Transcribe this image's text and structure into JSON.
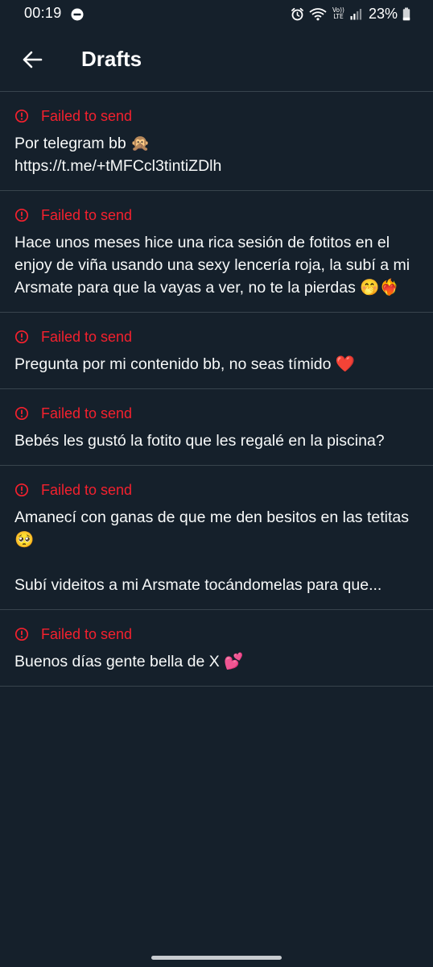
{
  "status_bar": {
    "time": "00:19",
    "battery": "23%",
    "network_label": "LTE",
    "volte_label": "Vo))"
  },
  "header": {
    "title": "Drafts"
  },
  "drafts": [
    {
      "status": "Failed to send",
      "text": "Por telegram bb 🙊\nhttps://t.me/+tMFCcl3tintiZDlh"
    },
    {
      "status": "Failed to send",
      "text": "Hace unos meses hice una rica sesión de fotitos en el enjoy de viña usando una sexy lencería roja, la subí a mi Arsmate para que la vayas a ver, no te la pierdas 🤭❤️‍🔥"
    },
    {
      "status": "Failed to send",
      "text": "Pregunta por mi contenido bb, no seas tímido ❤️"
    },
    {
      "status": "Failed to send",
      "text": "Bebés les gustó la fotito que les regalé en la piscina?"
    },
    {
      "status": "Failed to send",
      "text": "Amanecí con ganas de que me den besitos en las tetitas 🥺\n\nSubí videitos a mi Arsmate tocándomelas para que..."
    },
    {
      "status": "Failed to send",
      "text": "Buenos días gente bella de X 💕"
    }
  ],
  "colors": {
    "background": "#15202b",
    "divider": "#38444d",
    "error": "#f4212e",
    "text": "#f7f9f9"
  }
}
